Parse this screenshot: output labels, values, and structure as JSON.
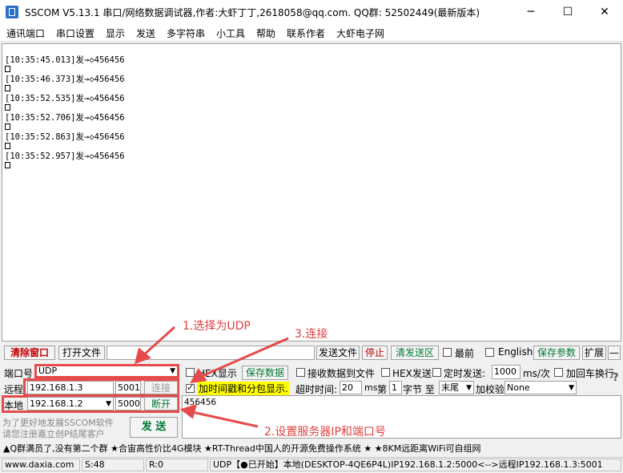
{
  "window": {
    "title": "SSCOM V5.13.1 串口/网络数据调试器,作者:大虾丁丁,2618058@qq.com. QQ群: 52502449(最新版本)",
    "minimize": "─",
    "maximize": "☐",
    "close": "✕"
  },
  "menu": [
    "通讯端口",
    "串口设置",
    "显示",
    "发送",
    "多字符串",
    "小工具",
    "帮助",
    "联系作者",
    "大虾电子网"
  ],
  "receive": {
    "lines": [
      {
        "time": "[10:35:45.013]",
        "text": "发→◇456456"
      },
      {
        "time": "[10:35:46.373]",
        "text": "发→◇456456"
      },
      {
        "time": "[10:35:52.535]",
        "text": "发→◇456456"
      },
      {
        "time": "[10:35:52.706]",
        "text": "发→◇456456"
      },
      {
        "time": "[10:35:52.863]",
        "text": "发→◇456456"
      },
      {
        "time": "[10:35:52.957]",
        "text": "发→◇456456"
      }
    ]
  },
  "toolbar": {
    "clear": "清除窗口",
    "open_file": "打开文件",
    "send_file": "发送文件",
    "stop": "停止",
    "clear_send": "清发送区",
    "top_most": "最前",
    "english": "English",
    "save_params": "保存参数",
    "expand": "扩展",
    "collapse": "—"
  },
  "port": {
    "label": "端口号",
    "value": "UDP",
    "hex_show": "HEX显示",
    "save_data": "保存数据",
    "recv_to_file": "接收数据到文件",
    "hex_send": "HEX发送",
    "timed_send": "定时发送:",
    "interval": "1000",
    "interval_unit": "ms/次",
    "add_newline": "加回车换行"
  },
  "remote": {
    "label": "远程",
    "ip": "192.168.1.3",
    "port": "5001",
    "connect": "连接",
    "timestamp": "加时间戳和分包显示.",
    "timeout_label": "超时时间:",
    "timeout": "20",
    "ms": "ms",
    "nth_label": "第",
    "nth": "1",
    "byte_label": "字节 至",
    "end_value": "末尾",
    "checksum_label": "加校验",
    "checksum": "None"
  },
  "local": {
    "label": "本地",
    "ip": "192.168.1.2",
    "port": "5000",
    "disconnect": "断开"
  },
  "send": {
    "text": "456456",
    "button": "发 送",
    "promo1": "为了更好地发展SSCOM软件",
    "promo2": "请您注册嘉立创P结尾客户"
  },
  "ticker": "▲Q群满员了,没有第二个群  ★合宙高性价比4G模块  ★RT-Thread中国人的开源免费操作系统  ★  ★8KM远距离WiFi可自组网",
  "status": {
    "site": "www.daxia.com",
    "sent": "S:48",
    "recv": "R:0",
    "conn": "UDP【●已开始】本地(DESKTOP-4QE6P4L)IP192.168.1.2:5000<-->远程IP192.168.1.3:5001"
  },
  "annotations": {
    "a1": "1.选择为UDP",
    "a2": "2.设置服务器IP和端口号",
    "a3": "3.连接"
  },
  "colors": {
    "annotation": "#e54b4b",
    "clear_button": "#c00000",
    "green_text": "#007a33",
    "timestamp_highlight": "#ffff00"
  }
}
